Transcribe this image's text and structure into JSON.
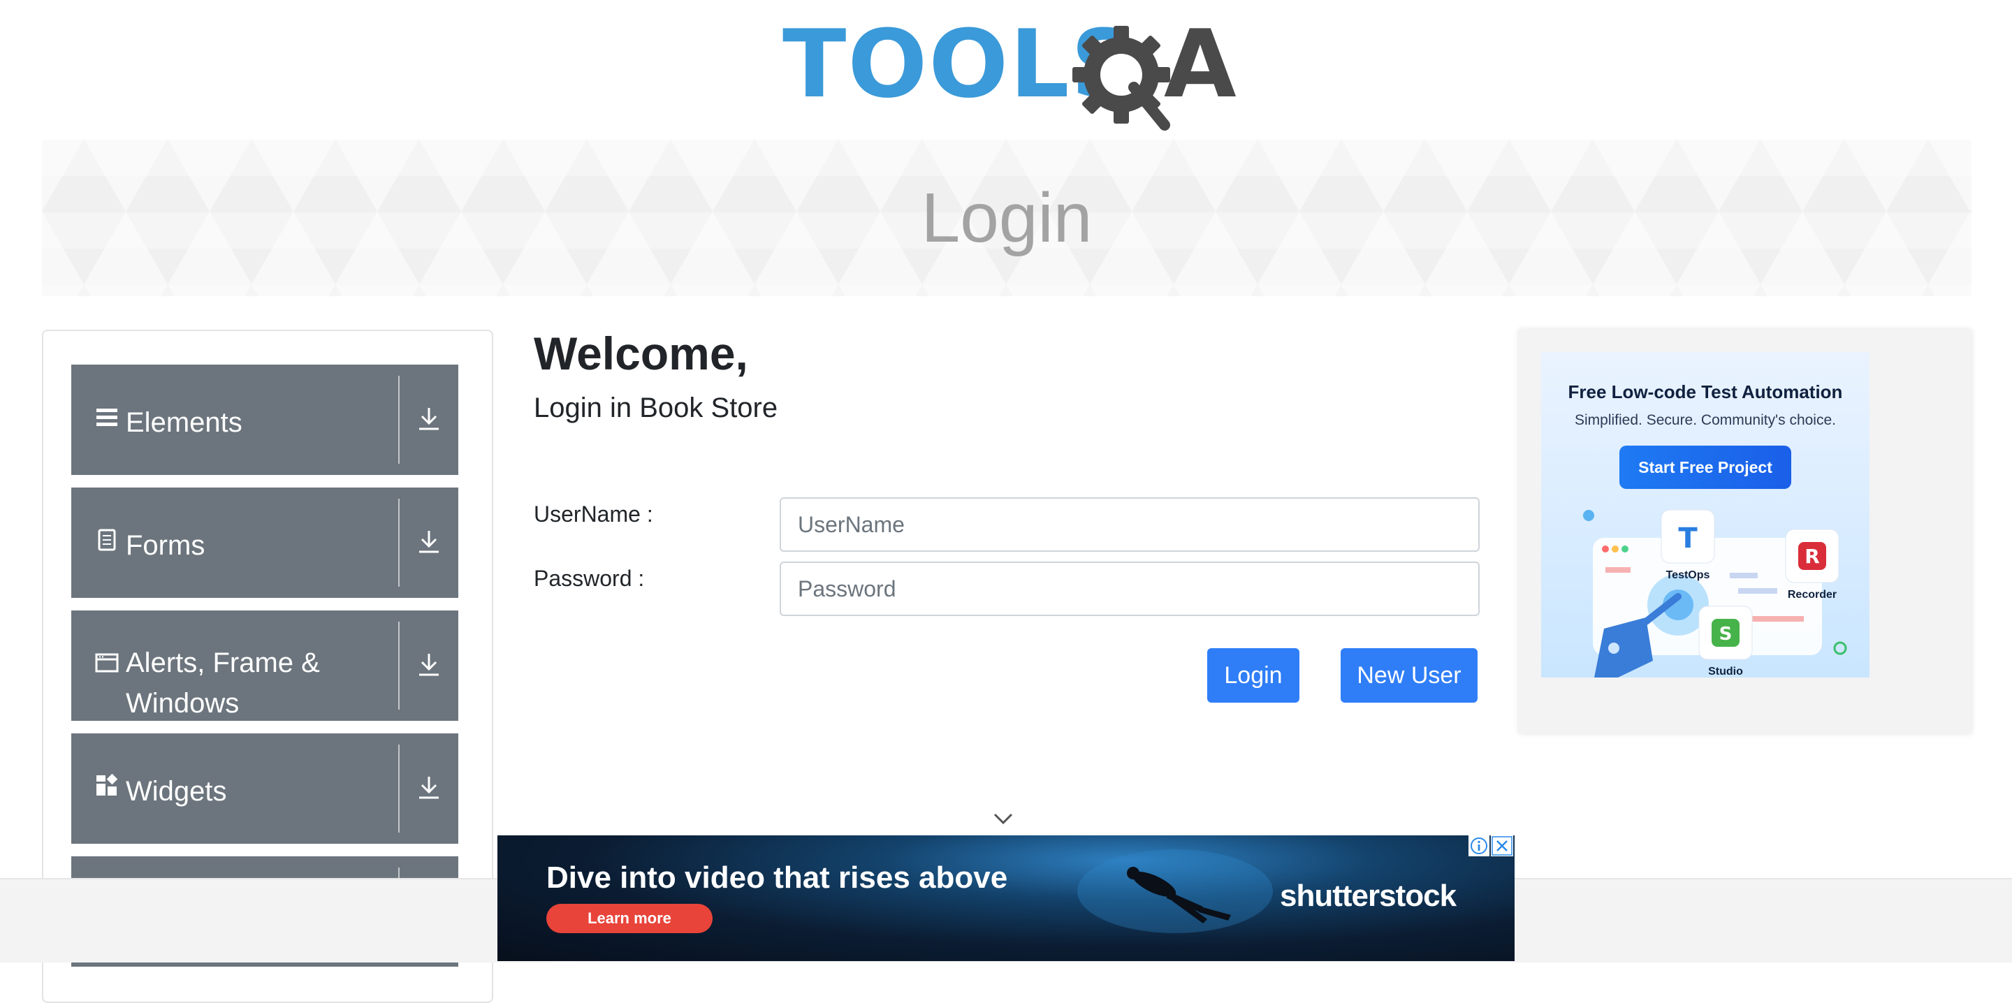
{
  "header": {
    "logo_text": "TOOLS",
    "logo_letter": "A"
  },
  "banner": {
    "title": "Login"
  },
  "sidebar": {
    "groups": [
      {
        "label": "Elements",
        "icon": "hamburger-icon"
      },
      {
        "label": "Forms",
        "icon": "document-icon"
      },
      {
        "label": "Alerts, Frame & Windows",
        "icon": "window-icon"
      },
      {
        "label": "Widgets",
        "icon": "widgets-icon"
      }
    ]
  },
  "main": {
    "welcome": "Welcome,",
    "subtitle": "Login in Book Store",
    "username_label": "UserName :",
    "username_placeholder": "UserName",
    "password_label": "Password :",
    "password_placeholder": "Password",
    "login_button": "Login",
    "new_user_button": "New User"
  },
  "ad_right": {
    "title": "Free Low-code Test Automation",
    "subtitle": "Simplified. Secure. Community's choice.",
    "cta": "Start Free Project",
    "labels": [
      "TestOps",
      "Recorder",
      "Studio"
    ]
  },
  "bottom_ad": {
    "headline": "Dive into video that rises above",
    "cta": "Learn more",
    "brand": "shutterstock"
  },
  "colors": {
    "accent": "#2f7ef7",
    "sidebar_group": "#6c757d",
    "logo_blue": "#3b9ad9",
    "logo_dark": "#4a4a4a"
  }
}
